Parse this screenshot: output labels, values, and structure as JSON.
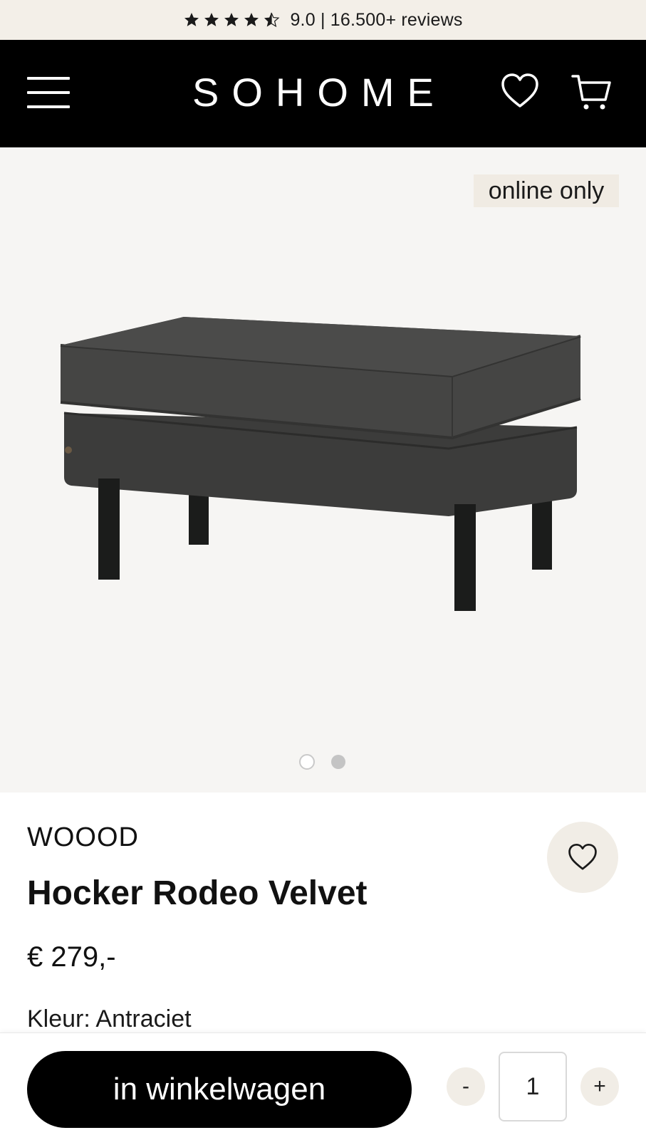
{
  "topbar": {
    "rating_value": "9.0",
    "review_text": "9.0 | 16.500+ reviews",
    "stars": 4.5,
    "icon": "star-icon"
  },
  "header": {
    "logo": "SOHOME",
    "menu_icon": "hamburger-menu-icon",
    "wishlist_icon": "heart-icon",
    "cart_icon": "cart-icon"
  },
  "gallery": {
    "badge": "online only",
    "image_count": 2,
    "active_index": 1
  },
  "product": {
    "brand": "WOOOD",
    "title": "Hocker Rodeo Velvet",
    "price": "€ 279,-",
    "color": "Kleur: Antraciet"
  },
  "purchase": {
    "add_to_cart_label": "in winkelwagen",
    "decrement_label": "-",
    "increment_label": "+",
    "quantity": "1"
  },
  "colors": {
    "topbar_bg": "#f3efe8",
    "header_bg": "#000000",
    "gallery_bg": "#f6f5f3",
    "accent_soft": "#f1ede6",
    "button_bg": "#000000"
  }
}
